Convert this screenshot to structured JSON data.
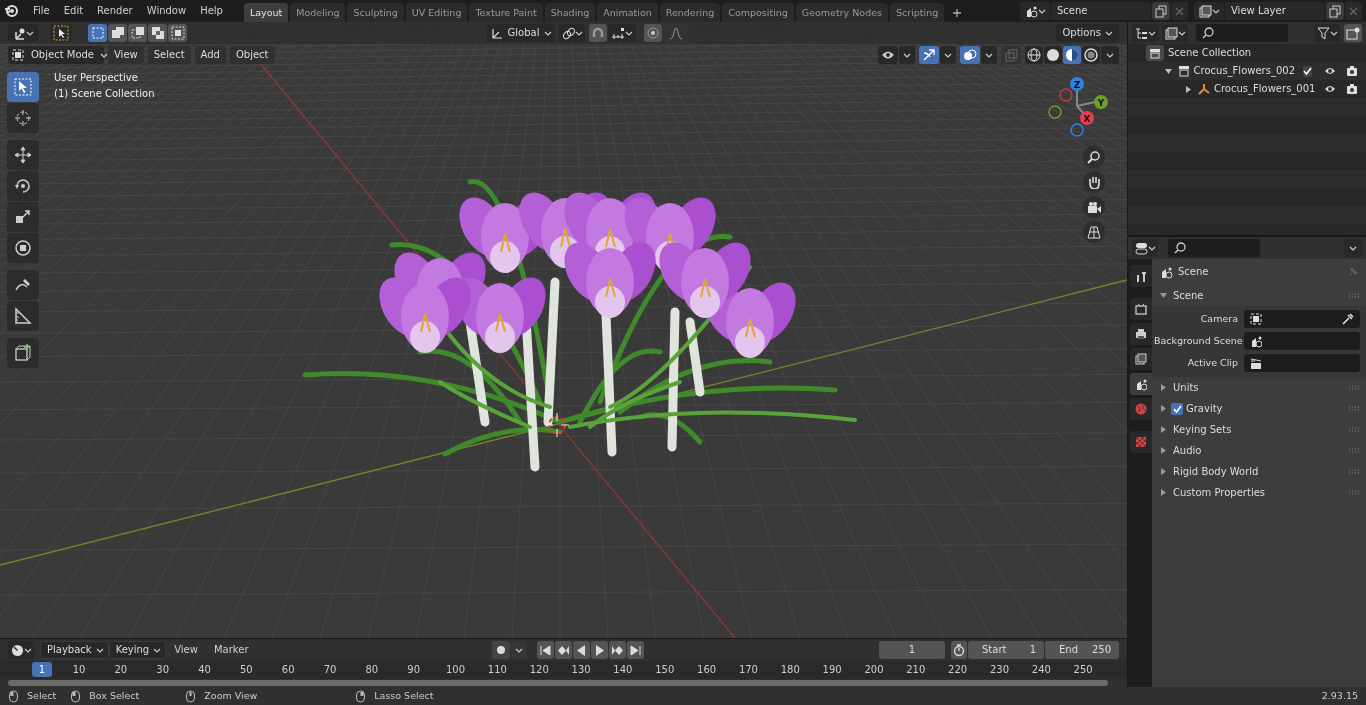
{
  "top_bar": {
    "menus": [
      "File",
      "Edit",
      "Render",
      "Window",
      "Help"
    ],
    "workspace_tabs": [
      {
        "label": "Layout",
        "selected": true
      },
      {
        "label": "Modeling",
        "selected": false
      },
      {
        "label": "Sculpting",
        "selected": false
      },
      {
        "label": "UV Editing",
        "selected": false
      },
      {
        "label": "Texture Paint",
        "selected": false
      },
      {
        "label": "Shading",
        "selected": false
      },
      {
        "label": "Animation",
        "selected": false
      },
      {
        "label": "Rendering",
        "selected": false
      },
      {
        "label": "Compositing",
        "selected": false
      },
      {
        "label": "Geometry Nodes",
        "selected": false
      },
      {
        "label": "Scripting",
        "selected": false
      }
    ],
    "scene_field": {
      "value": "Scene"
    },
    "view_layer_field": {
      "value": "View Layer"
    }
  },
  "viewport": {
    "tool_header": {
      "select_modes": [
        {
          "selected": true
        },
        {
          "selected": false
        },
        {
          "selected": false
        },
        {
          "selected": false
        },
        {
          "selected": false
        }
      ],
      "transform_orientation": "Global",
      "options_label": "Options"
    },
    "header": {
      "mode": "Object Mode",
      "menus": [
        "View",
        "Select",
        "Add",
        "Object"
      ],
      "shading_modes": [
        {
          "selected": false
        },
        {
          "selected": false
        },
        {
          "selected": true
        },
        {
          "selected": false
        }
      ]
    },
    "tools": [
      {
        "selected": true
      },
      {
        "selected": false
      },
      {
        "selected": false
      },
      {
        "selected": false
      },
      {
        "selected": false
      },
      {
        "selected": false
      },
      {
        "selected": false
      },
      {
        "selected": false
      },
      {
        "selected": false
      }
    ],
    "overlay_text": [
      "User Perspective",
      "(1) Scene Collection"
    ],
    "gizmo_axes": [
      "Z",
      "Y",
      "X"
    ]
  },
  "outliner": {
    "root": {
      "label": "Scene Collection",
      "children": [
        {
          "label": "Crocus_Flowers_002",
          "kind": "collection",
          "expanded": true,
          "checked": true,
          "children": [
            {
              "label": "Crocus_Flowers_001",
              "kind": "object",
              "expanded": false
            }
          ]
        }
      ]
    }
  },
  "properties": {
    "tabs": [
      {
        "selected": false
      },
      {
        "selected": false
      },
      {
        "selected": false
      },
      {
        "selected": false
      },
      {
        "selected": true
      },
      {
        "selected": false
      },
      {
        "selected": false
      }
    ],
    "context": "Scene",
    "panels": [
      {
        "title": "Scene",
        "expanded": true,
        "fields": [
          {
            "label": "Camera"
          },
          {
            "label": "Background Scene"
          },
          {
            "label": "Active Clip"
          }
        ]
      },
      {
        "title": "Units",
        "expanded": false
      },
      {
        "title": "Gravity",
        "expanded": false,
        "checked": true
      },
      {
        "title": "Keying Sets",
        "expanded": false
      },
      {
        "title": "Audio",
        "expanded": false
      },
      {
        "title": "Rigid Body World",
        "expanded": false
      },
      {
        "title": "Custom Properties",
        "expanded": false
      }
    ]
  },
  "timeline": {
    "menus": [
      {
        "label": "Playback",
        "kind": "dropdown"
      },
      {
        "label": "Keying",
        "kind": "dropdown"
      },
      {
        "label": "View",
        "kind": "menu"
      },
      {
        "label": "Marker",
        "kind": "menu"
      }
    ],
    "current_frame": "1",
    "start_label": "Start",
    "start_value": "1",
    "end_label": "End",
    "end_value": "250",
    "ruler_current": "1",
    "ruler_labels": [
      "10",
      "20",
      "30",
      "40",
      "50",
      "60",
      "70",
      "80",
      "90",
      "100",
      "110",
      "120",
      "130",
      "140",
      "150",
      "160",
      "170",
      "180",
      "190",
      "200",
      "210",
      "220",
      "230",
      "240",
      "250"
    ]
  },
  "status_bar": {
    "hints": [
      "Select",
      "Box Select",
      "Zoom View",
      "Lasso Select"
    ],
    "version": "2.93.15"
  }
}
